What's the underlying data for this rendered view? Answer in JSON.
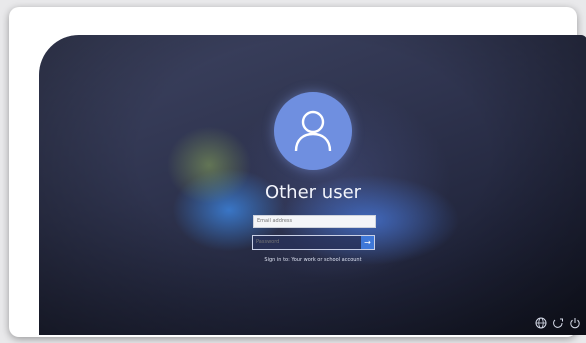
{
  "user": {
    "name": "Other user",
    "avatar_icon": "user-icon",
    "avatar_color": "#6f8fe0"
  },
  "form": {
    "email_placeholder": "Email address",
    "password_placeholder": "Password",
    "submit_icon": "arrow-right-icon",
    "sign_in_text": "Sign in to: Your work or school account",
    "accent_color": "#3f78d8"
  },
  "tray": {
    "icons": [
      "network-icon",
      "accessibility-icon",
      "power-icon"
    ]
  }
}
